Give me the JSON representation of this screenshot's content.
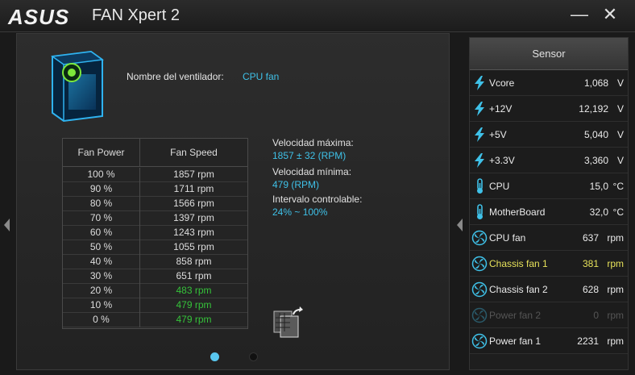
{
  "titlebar": {
    "logo": "ASUS",
    "title": "FAN Xpert 2",
    "minimize": "—",
    "close": "✕"
  },
  "fan": {
    "name_label": "Nombre del ventilador:",
    "name_value": "CPU fan"
  },
  "table": {
    "col_power": "Fan Power",
    "col_speed": "Fan Speed",
    "rows": [
      {
        "power": "100 %",
        "speed": "1857 rpm",
        "green": false
      },
      {
        "power": "90 %",
        "speed": "1711 rpm",
        "green": false
      },
      {
        "power": "80 %",
        "speed": "1566 rpm",
        "green": false
      },
      {
        "power": "70 %",
        "speed": "1397 rpm",
        "green": false
      },
      {
        "power": "60 %",
        "speed": "1243 rpm",
        "green": false
      },
      {
        "power": "50 %",
        "speed": "1055 rpm",
        "green": false
      },
      {
        "power": "40 %",
        "speed": "858 rpm",
        "green": false
      },
      {
        "power": "30 %",
        "speed": "651 rpm",
        "green": false
      },
      {
        "power": "20 %",
        "speed": "483 rpm",
        "green": true
      },
      {
        "power": "10 %",
        "speed": "479 rpm",
        "green": true
      },
      {
        "power": "0 %",
        "speed": "479 rpm",
        "green": true
      }
    ]
  },
  "info": {
    "max_label": "Velocidad máxima:",
    "max_value": "1857 ± 32 (RPM)",
    "min_label": "Velocidad mínima:",
    "min_value": "479 (RPM)",
    "range_label": "Intervalo controlable:",
    "range_value": "24% ~ 100%"
  },
  "pager": {
    "active_index": 0,
    "count": 2
  },
  "sensor": {
    "header": "Sensor",
    "items": [
      {
        "icon": "voltage-icon",
        "name": "Vcore",
        "value": "1,068",
        "unit": "V",
        "state": "normal"
      },
      {
        "icon": "voltage-icon",
        "name": "+12V",
        "value": "12,192",
        "unit": "V",
        "state": "normal"
      },
      {
        "icon": "voltage-icon",
        "name": "+5V",
        "value": "5,040",
        "unit": "V",
        "state": "normal"
      },
      {
        "icon": "voltage-icon",
        "name": "+3.3V",
        "value": "3,360",
        "unit": "V",
        "state": "normal"
      },
      {
        "icon": "thermometer-icon",
        "name": "CPU",
        "value": "15,0",
        "unit": "°C",
        "state": "normal"
      },
      {
        "icon": "thermometer-icon",
        "name": "MotherBoard",
        "value": "32,0",
        "unit": "°C",
        "state": "normal"
      },
      {
        "icon": "fan-icon",
        "name": "CPU fan",
        "value": "637",
        "unit": "rpm",
        "state": "normal"
      },
      {
        "icon": "fan-icon",
        "name": "Chassis fan 1",
        "value": "381",
        "unit": "rpm",
        "state": "highlight"
      },
      {
        "icon": "fan-icon",
        "name": "Chassis fan 2",
        "value": "628",
        "unit": "rpm",
        "state": "normal"
      },
      {
        "icon": "fan-icon",
        "name": "Power fan 2",
        "value": "0",
        "unit": "rpm",
        "state": "dim"
      },
      {
        "icon": "fan-icon",
        "name": "Power fan 1",
        "value": "2231",
        "unit": "rpm",
        "state": "normal"
      }
    ]
  },
  "colors": {
    "accent": "#3fc1e8",
    "green": "#35c23a",
    "highlight": "#e7e25a",
    "dim": "#555555"
  }
}
